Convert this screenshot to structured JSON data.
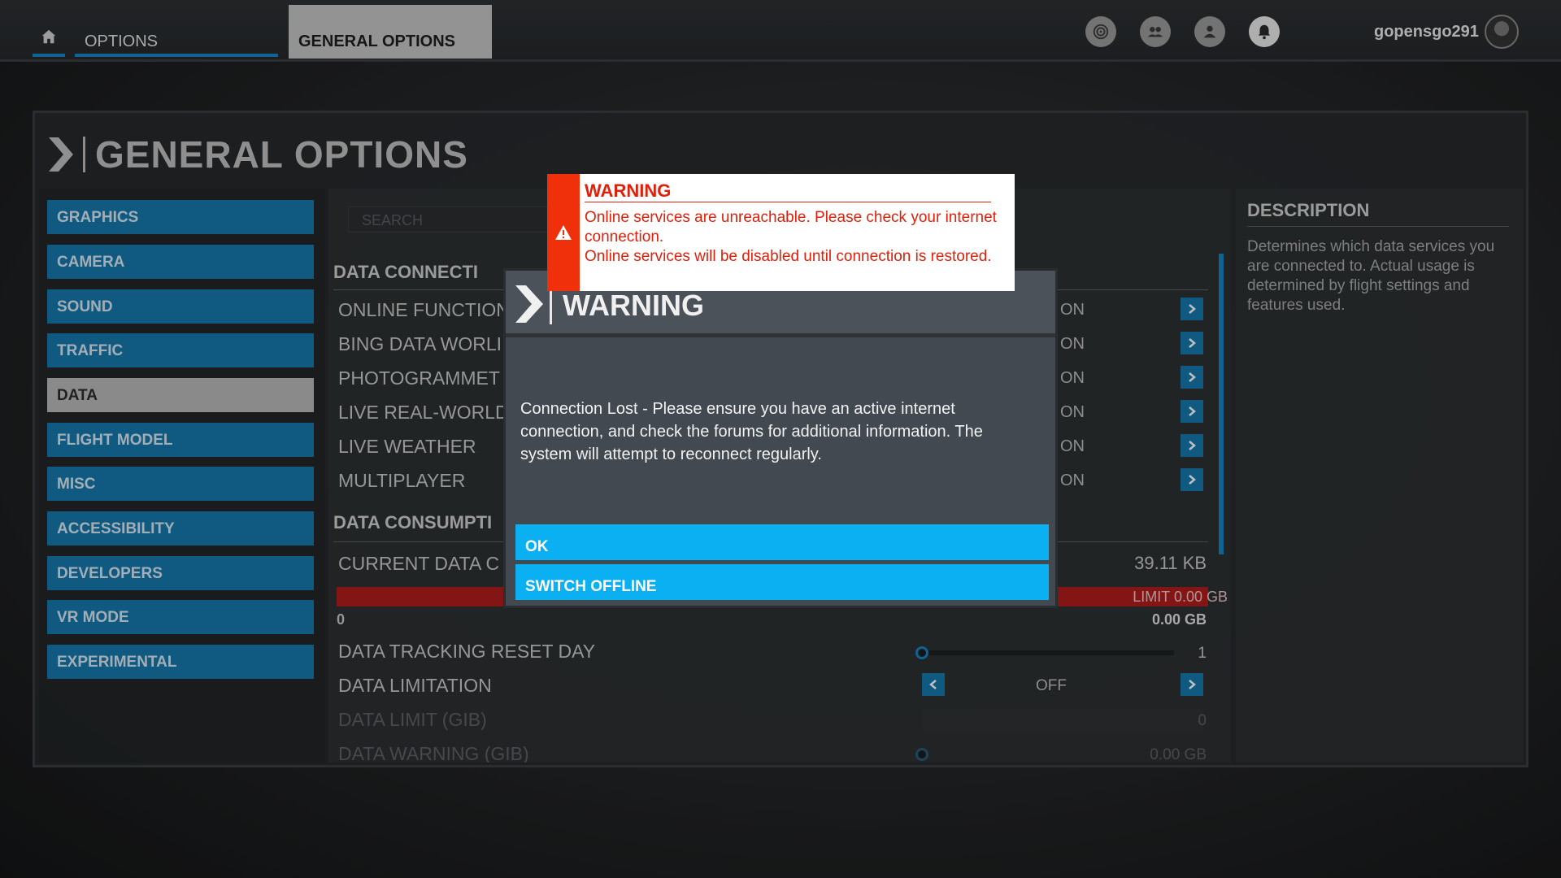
{
  "topbar": {
    "home_icon": "home-icon",
    "tab_options": "OPTIONS",
    "tab_general": "GENERAL OPTIONS",
    "icons": [
      "achievements-icon",
      "friends-icon",
      "profile-icon",
      "notifications-icon"
    ],
    "username": "gopensgo291"
  },
  "page": {
    "title": "GENERAL OPTIONS"
  },
  "nav": {
    "items": [
      {
        "label": "GRAPHICS"
      },
      {
        "label": "CAMERA"
      },
      {
        "label": "SOUND"
      },
      {
        "label": "TRAFFIC"
      },
      {
        "label": "DATA",
        "selected": true
      },
      {
        "label": "FLIGHT MODEL"
      },
      {
        "label": "MISC"
      },
      {
        "label": "ACCESSIBILITY"
      },
      {
        "label": "DEVELOPERS"
      },
      {
        "label": "VR MODE"
      },
      {
        "label": "EXPERIMENTAL"
      }
    ]
  },
  "content": {
    "search_placeholder": "SEARCH",
    "section_connection": "DATA CONNECTI",
    "rows": [
      {
        "label": "ONLINE FUNCTION",
        "value": "ON"
      },
      {
        "label": "BING DATA WORLI",
        "value": "ON"
      },
      {
        "label": "PHOTOGRAMMET",
        "value": "ON"
      },
      {
        "label": "LIVE REAL-WORLD",
        "value": "ON"
      },
      {
        "label": "LIVE WEATHER",
        "value": "ON"
      },
      {
        "label": "MULTIPLAYER",
        "value": "ON"
      }
    ],
    "section_consumption": "DATA CONSUMPTI",
    "current_data_label": "CURRENT DATA C",
    "current_data_value": "39.11 KB",
    "limit_label": "LIMIT 0.00 GB",
    "scale_min": "0",
    "scale_max": "0.00 GB",
    "reset_day_label": "DATA TRACKING RESET DAY",
    "reset_day_value": "1",
    "limitation_label": "DATA LIMITATION",
    "limitation_value": "OFF",
    "data_limit_label": "DATA LIMIT (GIB)",
    "data_limit_value": "0",
    "data_warning_label": "DATA WARNING (GIB)",
    "data_warning_value": "0.00 GB"
  },
  "description": {
    "title": "DESCRIPTION",
    "text": "Determines which data services you are connected to. Actual usage is determined by flight settings and features used."
  },
  "dialog": {
    "title": "WARNING",
    "message": "Connection Lost - Please ensure you have an active internet connection, and check the forums for additional information. The system will attempt to reconnect regularly.",
    "ok_label": "OK",
    "offline_label": "SWITCH OFFLINE"
  },
  "toast": {
    "title": "WARNING",
    "line1": "Online services are unreachable. Please check your internet connection.",
    "line2": "Online services will be disabled until connection is restored.",
    "color": "#e0200a"
  },
  "colors": {
    "accent": "#1677ad",
    "button": "#0bb0f3",
    "alert": "#f0300a"
  }
}
